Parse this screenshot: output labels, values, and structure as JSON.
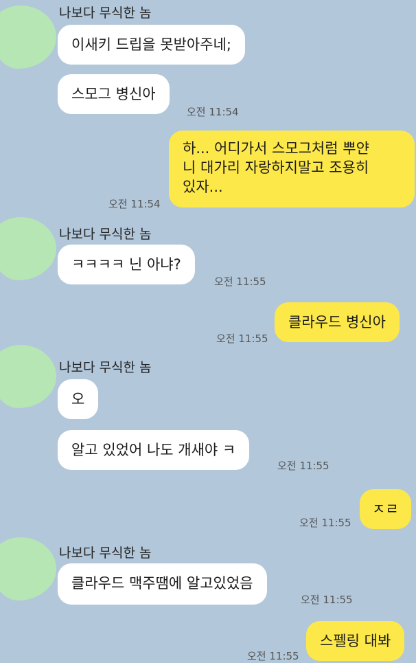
{
  "sender_name": "나보다 무식한 놈",
  "sender_name_cut": "나보다 무식한 놈",
  "messages": [
    {
      "text": "이새키 드립을 못받아주네;"
    },
    {
      "text": "스모그 병신아",
      "time": "오전 11:54"
    },
    {
      "text": "하... 어디가서 스모그처럼 뿌얀\n니 대가리 자랑하지말고 조용히\n있자...",
      "time": "오전 11:54"
    },
    {
      "text": "ㅋㅋㅋㅋ 닌 아냐?",
      "time": "오전 11:55"
    },
    {
      "text": "클라우드 병신아",
      "time": "오전 11:55"
    },
    {
      "text": "오"
    },
    {
      "text": "알고 있었어 나도 개새야 ㅋ",
      "time": "오전 11:55"
    },
    {
      "text": "ㅈㄹ",
      "time": "오전 11:55"
    },
    {
      "text": "클라우드 맥주땜에 알고있었음",
      "time": "오전 11:55"
    },
    {
      "text": "스펠링 대봐",
      "time": "오전 11:55"
    }
  ]
}
